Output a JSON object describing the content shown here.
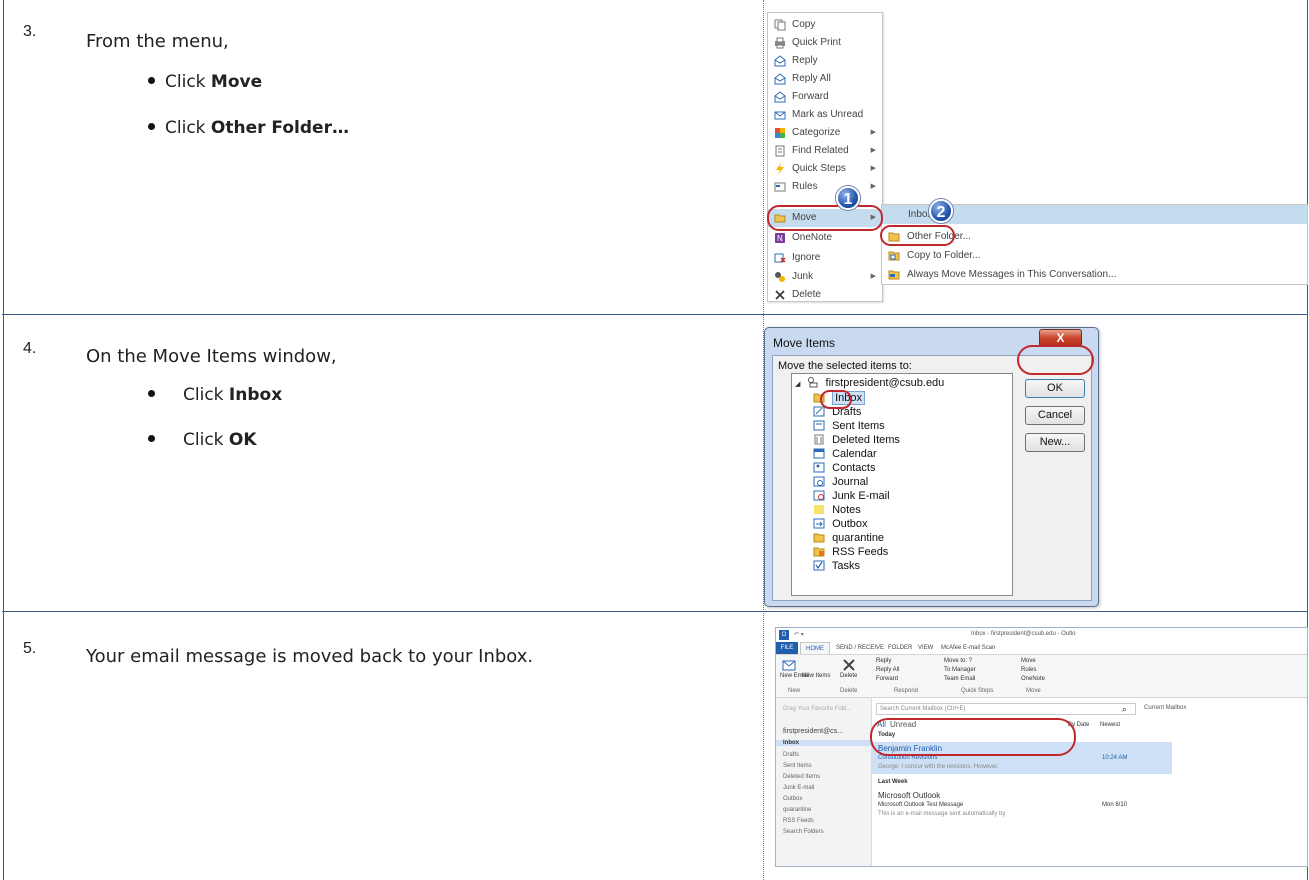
{
  "steps": [
    {
      "number": "3.",
      "text": "From the menu,",
      "bullets": [
        {
          "prefix": "Click ",
          "bold": "Move"
        },
        {
          "prefix": "Click ",
          "bold": "Other Folder…"
        }
      ]
    },
    {
      "number": "4.",
      "text": "On the Move Items window,",
      "bullets": [
        {
          "prefix": "Click ",
          "bold": "Inbox"
        },
        {
          "prefix": "Click ",
          "bold": "OK"
        }
      ]
    },
    {
      "number": "5.",
      "text": "Your email message is moved back to your Inbox."
    }
  ],
  "context_menu": {
    "items": [
      "Copy",
      "Quick Print",
      "Reply",
      "Reply All",
      "Forward",
      "Mark as Unread",
      "Categorize",
      "Find Related",
      "Quick Steps",
      "Rules",
      "Move",
      "OneNote",
      "Ignore",
      "Junk",
      "Delete"
    ],
    "submenu": [
      "Inbox",
      "Other Folder...",
      "Copy to Folder...",
      "Always Move Messages in This Conversation..."
    ],
    "callouts": [
      "1",
      "2"
    ]
  },
  "move_dialog": {
    "title": "Move Items",
    "close": "X",
    "label": "Move the selected items to:",
    "account": "firstpresident@csub.edu",
    "folders": [
      "Inbox",
      "Drafts",
      "Sent Items",
      "Deleted Items",
      "Calendar",
      "Contacts",
      "Journal",
      "Junk E-mail",
      "Notes",
      "Outbox",
      "quarantine",
      "RSS Feeds",
      "Tasks"
    ],
    "buttons": {
      "ok": "OK",
      "cancel": "Cancel",
      "new": "New..."
    }
  },
  "outlook": {
    "title": "Inbox - firstpresident@csub.edu - Outlo",
    "tabs": [
      "FILE",
      "HOME",
      "SEND / RECEIVE",
      "FOLDER",
      "VIEW",
      "McAfee E-mail Scan"
    ],
    "ribbon": {
      "new_email": "New Email",
      "new_items": "New Items",
      "delete": "Delete",
      "reply": "Reply",
      "reply_all": "Reply All",
      "forward": "Forward",
      "move_to": "Move to: ?",
      "to_manager": "To Manager",
      "team_email": "Team Email",
      "move": "Move",
      "rules": "Rules",
      "onenote": "OneNote",
      "groups": [
        "New",
        "Delete",
        "Respond",
        "Quick Steps",
        "Move"
      ]
    },
    "nav": {
      "favorites": "Drag Your Favorite Fold...",
      "account": "firstpresident@cs...",
      "folders": [
        "Inbox",
        "Drafts",
        "Sent Items",
        "Deleted Items",
        "Junk E-mail",
        "Outbox",
        "quarantine",
        "RSS Feeds",
        "Search Folders"
      ]
    },
    "search_placeholder": "Search Current Mailbox (Ctrl+E)",
    "scope": "Current Mailbox",
    "filter_all": "All",
    "filter_unread": "Unread",
    "sort": "By Date",
    "order": "Newest",
    "groups": [
      "Today",
      "Last Week"
    ],
    "messages": [
      {
        "sender": "Benjamin Franklin",
        "subject": "Constitution Revisions",
        "preview": "George:  I concur with the revisions.  However,",
        "time": "10:24 AM"
      },
      {
        "sender": "Microsoft Outlook",
        "subject": "Microsoft Outlook Test Message",
        "preview": "This is an e-mail message sent automatically by",
        "time": "Mon 8/10"
      }
    ]
  }
}
